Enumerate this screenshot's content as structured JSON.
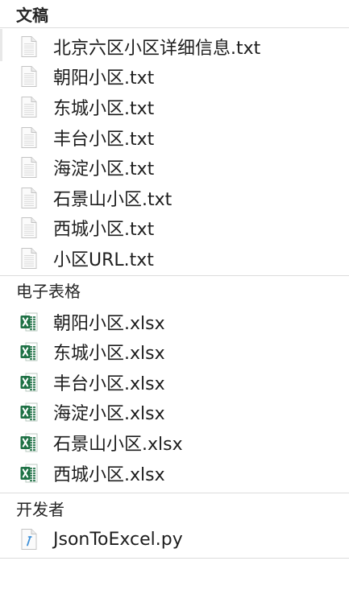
{
  "sections": {
    "documents": {
      "title": "文稿",
      "items": [
        {
          "label": "北京六区小区详细信息.txt",
          "icon": "text-file-icon"
        },
        {
          "label": "朝阳小区.txt",
          "icon": "text-file-icon"
        },
        {
          "label": "东城小区.txt",
          "icon": "text-file-icon"
        },
        {
          "label": "丰台小区.txt",
          "icon": "text-file-icon"
        },
        {
          "label": "海淀小区.txt",
          "icon": "text-file-icon"
        },
        {
          "label": "石景山小区.txt",
          "icon": "text-file-icon"
        },
        {
          "label": "西城小区.txt",
          "icon": "text-file-icon"
        },
        {
          "label": "小区URL.txt",
          "icon": "text-file-icon"
        }
      ]
    },
    "spreadsheets": {
      "title": "电子表格",
      "items": [
        {
          "label": "朝阳小区.xlsx",
          "icon": "excel-file-icon"
        },
        {
          "label": "东城小区.xlsx",
          "icon": "excel-file-icon"
        },
        {
          "label": "丰台小区.xlsx",
          "icon": "excel-file-icon"
        },
        {
          "label": "海淀小区.xlsx",
          "icon": "excel-file-icon"
        },
        {
          "label": "石景山小区.xlsx",
          "icon": "excel-file-icon"
        },
        {
          "label": "西城小区.xlsx",
          "icon": "excel-file-icon"
        }
      ]
    },
    "developer": {
      "title": "开发者",
      "items": [
        {
          "label": "JsonToExcel.py",
          "icon": "python-file-icon"
        }
      ]
    }
  },
  "colors": {
    "excel_green": "#1e7145",
    "python_blue": "#3b8ed8",
    "divider": "#dcdcdc"
  }
}
